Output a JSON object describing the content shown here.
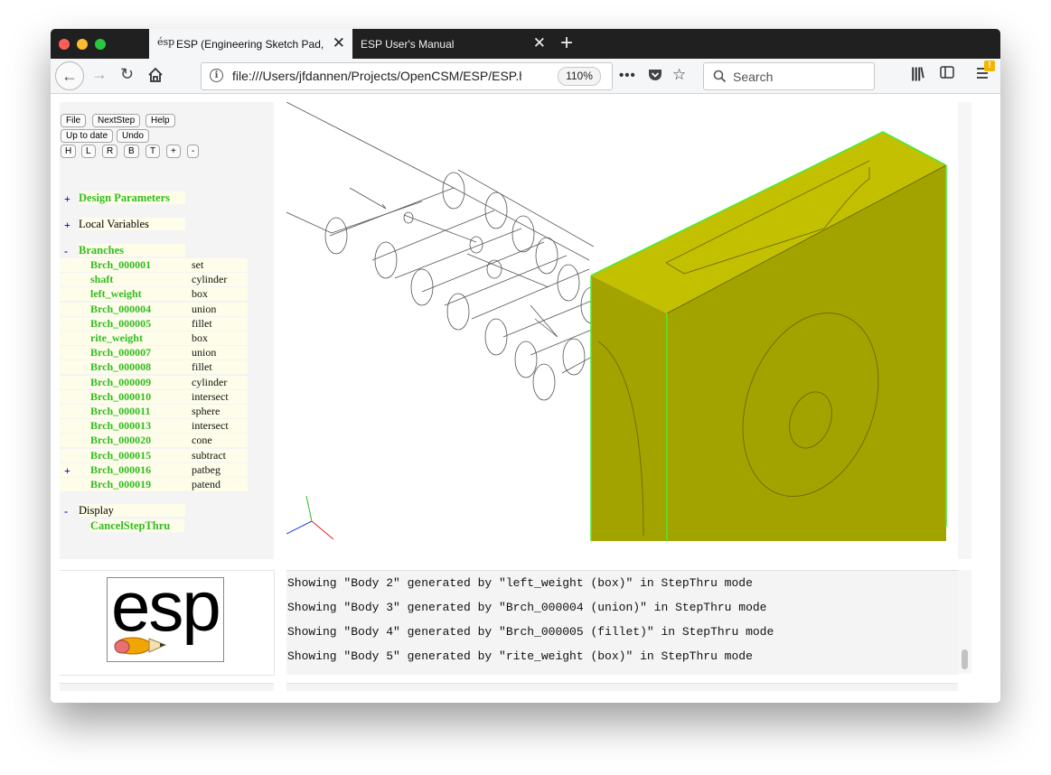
{
  "browser": {
    "tabs": [
      {
        "title": "ESP (Engineering Sketch Pad, V",
        "favicon": "esp-favicon",
        "active": true
      },
      {
        "title": "ESP User's Manual",
        "active": false
      }
    ],
    "url": "file:///Users/jfdannen/Projects/OpenCSM/ESP/ESP.h",
    "zoom": "110%",
    "search_placeholder": "Search"
  },
  "toolbar": {
    "row1": [
      "File",
      "NextStep",
      "Help"
    ],
    "row2": [
      "Up to date",
      "Undo"
    ],
    "row3": [
      "H",
      "L",
      "R",
      "B",
      "T",
      "+",
      "-"
    ]
  },
  "tree": {
    "design_parameters": {
      "toggle": "+",
      "label": "Design Parameters"
    },
    "local_variables": {
      "toggle": "+",
      "label": "Local Variables"
    },
    "branches": {
      "toggle": "-",
      "label": "Branches",
      "items": [
        {
          "toggle": "",
          "name": "Brch_000001",
          "type": "set"
        },
        {
          "toggle": "",
          "name": "shaft",
          "type": "cylinder"
        },
        {
          "toggle": "",
          "name": "left_weight",
          "type": "box"
        },
        {
          "toggle": "",
          "name": "Brch_000004",
          "type": "union"
        },
        {
          "toggle": "",
          "name": "Brch_000005",
          "type": "fillet"
        },
        {
          "toggle": "",
          "name": "rite_weight",
          "type": "box"
        },
        {
          "toggle": "",
          "name": "Brch_000007",
          "type": "union"
        },
        {
          "toggle": "",
          "name": "Brch_000008",
          "type": "fillet"
        },
        {
          "toggle": "",
          "name": "Brch_000009",
          "type": "cylinder"
        },
        {
          "toggle": "",
          "name": "Brch_000010",
          "type": "intersect"
        },
        {
          "toggle": "",
          "name": "Brch_000011",
          "type": "sphere"
        },
        {
          "toggle": "",
          "name": "Brch_000013",
          "type": "intersect"
        },
        {
          "toggle": "",
          "name": "Brch_000020",
          "type": "cone"
        },
        {
          "toggle": "",
          "name": "Brch_000015",
          "type": "subtract"
        },
        {
          "toggle": "+",
          "name": "Brch_000016",
          "type": "patbeg"
        },
        {
          "toggle": "",
          "name": "Brch_000019",
          "type": "patend"
        }
      ]
    },
    "display": {
      "toggle": "-",
      "label": "Display",
      "child": "CancelStepThru"
    }
  },
  "logo": {
    "text": "esp"
  },
  "messages": [
    "Showing \"Body 2\" generated by \"left_weight (box)\" in StepThru mode",
    "Showing \"Body 3\" generated by \"Brch_000004 (union)\" in StepThru mode",
    "Showing \"Body 4\" generated by \"Brch_000005 (fillet)\" in StepThru mode",
    "Showing \"Body 5\" generated by \"rite_weight (box)\" in StepThru mode"
  ],
  "colors": {
    "branch_green": "#33bb22",
    "body_face": "#c2c000",
    "body_side": "#a3a300",
    "body_edge": "#44ee33"
  }
}
